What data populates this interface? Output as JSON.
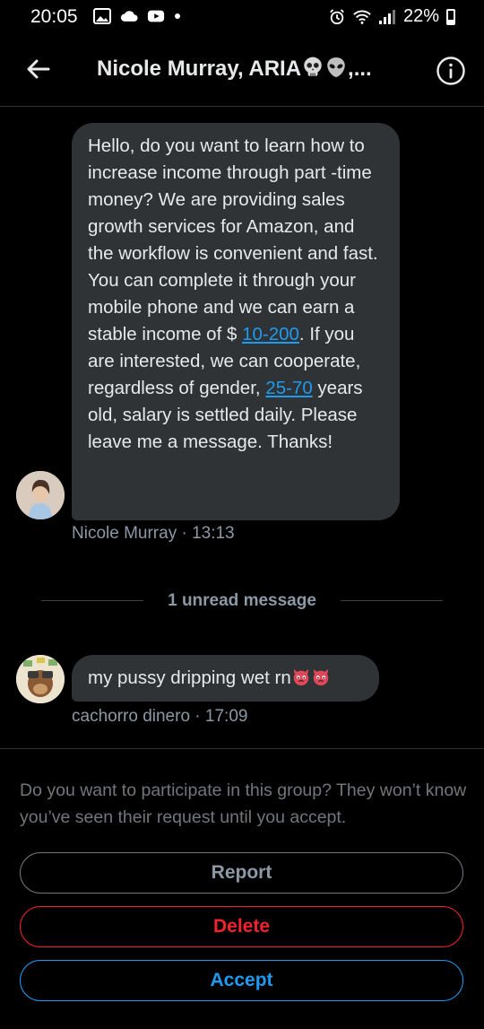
{
  "status_bar": {
    "time": "20:05",
    "battery": "22%",
    "icons": [
      "gallery-icon",
      "cloud-icon",
      "youtube-icon",
      "dot-icon",
      "alarm-icon",
      "wifi-icon",
      "signal-icon",
      "battery-icon"
    ]
  },
  "header": {
    "title": "Nicole Murray, ARIA",
    "title_suffix": ",...",
    "emojis": [
      "skull-emoji",
      "alien-emoji"
    ],
    "back_icon": "back-arrow-icon",
    "info_icon": "info-icon"
  },
  "messages": [
    {
      "sender": "Nicole Murray",
      "time": "13:13",
      "meta": "Nicole Murray · 13:13",
      "text_parts": {
        "p1": "Hello, do you want to learn how to increase income through part -time money? We are providing sales growth services for Amazon, and the workflow is convenient and fast. You can complete it through your mobile phone and we can earn a stable income of $ ",
        "link1": "10-200",
        "p2": ". If you are interested, we can cooperate, regardless of gender, ",
        "link2": "25-70",
        "p3": " years old, salary is settled daily. Please leave me a message. Thanks!"
      }
    },
    {
      "sender": "cachorro dinero",
      "time": "17:09",
      "meta": "cachorro dinero · 17:09",
      "text": "my pussy dripping wet rn",
      "emojis": [
        "devil-face-emoji",
        "devil-face-emoji"
      ]
    }
  ],
  "unread_divider": "1 unread message",
  "request": {
    "prompt": "Do you want to participate in this group? They won’t know you’ve seen their request until you accept.",
    "report_label": "Report",
    "delete_label": "Delete",
    "accept_label": "Accept"
  },
  "colors": {
    "background": "#000000",
    "bubble": "#2f3336",
    "link": "#1d9bf0",
    "delete": "#f4212e",
    "accept": "#1d9bf0",
    "muted": "#8b98a5"
  }
}
